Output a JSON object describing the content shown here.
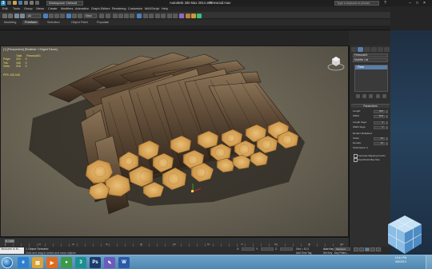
{
  "titlebar": {
    "workspace": "Workspace: Default",
    "app_title": "Autodesk 3ds Max  2014 x64",
    "filename": "Firewood.max",
    "search_placeholder": "Type a keyword or phrase"
  },
  "menus": [
    "Edit",
    "Tools",
    "Group",
    "Views",
    "Create",
    "Modifiers",
    "Animation",
    "Graph Editors",
    "Rendering",
    "Customize",
    "MAXScript",
    "Help"
  ],
  "toolbar": {
    "selection_filter": "All",
    "view_dropdown": "View"
  },
  "ribbon": {
    "tabs": [
      "Modeling",
      "Freeform",
      "Selection",
      "Object Paint",
      "Populate"
    ],
    "active_tab": "Freeform"
  },
  "viewport": {
    "label": "[+] [Perspective] [Realistic + Edged Faces]",
    "stats_header": [
      "Total",
      "Firewood01"
    ],
    "stats": [
      {
        "name": "Polys:",
        "total": "224",
        "sel": "0"
      },
      {
        "name": "Tris:",
        "total": "448",
        "sel": "0"
      },
      {
        "name": "Verts:",
        "total": "218",
        "sel": "0"
      }
    ],
    "fps": "FPS:    100.045"
  },
  "command_panel": {
    "object_name": "Firewood01",
    "modifier_list": "Modifier List",
    "stack_item": "Plane",
    "rollout_title": "Parameters",
    "params": [
      {
        "label": "Length:",
        "value": "64.0"
      },
      {
        "label": "Width:",
        "value": "64.0"
      },
      {
        "label": "Length Segs:",
        "value": "4"
      },
      {
        "label": "Width Segs:",
        "value": "4"
      },
      {
        "label": "Render Multipliers",
        "value": ""
      },
      {
        "label": "Scale:",
        "value": "1.0"
      },
      {
        "label": "Density:",
        "value": "1.0"
      },
      {
        "label": "Total Faces: 0",
        "value": ""
      }
    ],
    "checks": [
      "Generate Mapping Coords.",
      "Real-World Map Size"
    ]
  },
  "timeline": {
    "slider_text": "0 / 100",
    "ticks": [
      "0",
      "10",
      "20",
      "30",
      "40",
      "50",
      "60",
      "70",
      "80",
      "90",
      "100"
    ]
  },
  "status": {
    "maxscript": "Welcome to M...",
    "message1": "1 Object Selected",
    "message2": "Click and drag to select and move objects",
    "x_label": "X:",
    "y_label": "Y:",
    "z_label": "Z:",
    "grid": "Grid = 10.0",
    "auto_key": "Auto Key",
    "selected": "Selected",
    "set_key": "Set Key",
    "key_filters": "Key Filters...",
    "add_time_tag": "Add Time Tag"
  },
  "taskbar": {
    "apps": [
      {
        "icon": "ie-icon",
        "color": "#2f7fd0",
        "glyph": "e"
      },
      {
        "icon": "folder-icon",
        "color": "#d9a33a",
        "glyph": "▤"
      },
      {
        "icon": "media-icon",
        "color": "#e06a1c",
        "glyph": "▶"
      },
      {
        "icon": "chrome-icon",
        "color": "#3c9a4a",
        "glyph": "●"
      },
      {
        "icon": "3dsmax-icon",
        "color": "#1b8f8f",
        "glyph": "3"
      },
      {
        "icon": "photoshop-icon",
        "color": "#1a3c6e",
        "glyph": "Ps"
      },
      {
        "icon": "paint-icon",
        "color": "#6a5bbd",
        "glyph": "✎"
      },
      {
        "icon": "word-icon",
        "color": "#2b5aa8",
        "glyph": "W"
      }
    ],
    "time": "13:41 PM",
    "date": "6/6/2013"
  },
  "colors": {
    "viewport_bg": "#6b6555",
    "bark_dark": "#3e2e22",
    "bark_light": "#7a6248",
    "end_grain": "#d9a85a",
    "stats_yellow": "#f0e060",
    "accent_blue": "#5a7ea8"
  }
}
